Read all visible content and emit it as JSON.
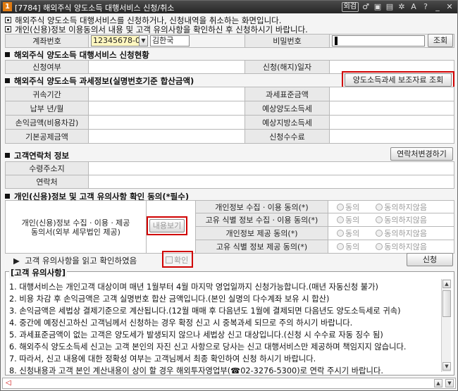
{
  "window": {
    "number": "1",
    "title": "[7784] 해외주식 양도소득 대행서비스 신청/취소",
    "tag": "외검",
    "icons": [
      "link-icon",
      "pin-icon",
      "window-icon",
      "gear-icon",
      "help-icon",
      "minimize-icon",
      "close-icon"
    ],
    "icon_glyphs": [
      "♂",
      "▣",
      "▤",
      "✲",
      "A",
      "?",
      "_",
      "✕"
    ]
  },
  "info_lines": [
    "해외주식 양도소득 대행서비스를 신청하거나, 신청내역을 취소하는 화면입니다.",
    "개인(신용)정보 이용동의서 내용 및 고객 유의사항을 확인하신 후 신청하시기 바랍니다."
  ],
  "account": {
    "label": "계좌번호",
    "number": "12345678-01",
    "name": "김한국",
    "password_label": "비밀번호",
    "query_button": "조회"
  },
  "status_section": {
    "title": "해외주식 양도소득 대행서비스 신청현황",
    "apply_label": "신청여부",
    "date_label": "신청(해지)일자"
  },
  "tax_section": {
    "title": "해외주식 양도소득 과세정보(실명번호기준 합산금액)",
    "support_button": "양도소득과세 보조자료 조회",
    "rows": [
      {
        "left": "귀속기간",
        "right": "과세표준금액"
      },
      {
        "left": "납부 년/월",
        "right": "예상양도소득세"
      },
      {
        "left": "손익금액(비용차감)",
        "right": "예상지방소득세"
      },
      {
        "left": "기본공제금액",
        "right": "신청수수료"
      }
    ]
  },
  "contact_section": {
    "title": "고객연락처 정보",
    "change_button": "연락처변경하기",
    "address_label": "수령주소지",
    "phone_label": "연락처"
  },
  "consent_section": {
    "title": "개인(신용)정보 및 고객 유의사항 확인 동의(*필수)",
    "left_label_1": "개인(신용)정보 수집ㆍ이용ㆍ제공",
    "left_label_2": "동의서(외부 세무법인 제공)",
    "view_button": "내용보기",
    "agree": "동의",
    "disagree": "동의하지않음",
    "items": [
      "개인정보 수집ㆍ이용 동의(*)",
      "고유 식별 정보 수집ㆍ이용 동의(*)",
      "개인정보 제공 동의(*)",
      "고유 식별 정보 제공 동의(*)"
    ]
  },
  "confirm": {
    "text": "고객 유의사항을 읽고 확인하였음",
    "checkbox_label": "확인",
    "apply_button": "신청"
  },
  "notice": {
    "title": "[고객 유의사항]",
    "lines": [
      "1. 대행서비스는 개인고객 대상이며 매년 1월부터 4월 마지막 영업일까지 신청가능합니다.(매년 자동신청 불가)",
      "2. 비용 차감 후 손익금액은 고객 실명번호 합산 금액입니다.(본인 실명의 다수계좌 보유 시 합산)",
      "3. 손익금액은 세법상 결제기준으로 계산됩니다.(12월 매매 후 다음년도 1월에 결제되면 다음년도 양도소득세로 귀속)",
      "4. 중간에 예정신고하신 고객님께서 신청하는 경우 확정 신고 시 중복과세 되므로 주의 하시기 바랍니다.",
      "5. 과세표준금액이 없는 고객은 양도세가 발생되지 않으나 세법상 신고 대상입니다.(신청 시 수수료 자동 징수 됨)",
      "6. 해외주식 양도소득세 신고는 고객 본인의 자진 신고 사항으로 당사는 신고 대행서비스만 제공하며 책임지지 않습니다.",
      "7. 따라서, 신고 내용에 대한 정확성 여부는 고객님께서 최종 확인하여 신청 하시기 바랍니다.",
      "8. 신청내용과 고객 본인 계산내용이 상이 할 경우 해외투자영업부(☎02-3276-5300)로 연락 주시기 바랍니다."
    ]
  }
}
